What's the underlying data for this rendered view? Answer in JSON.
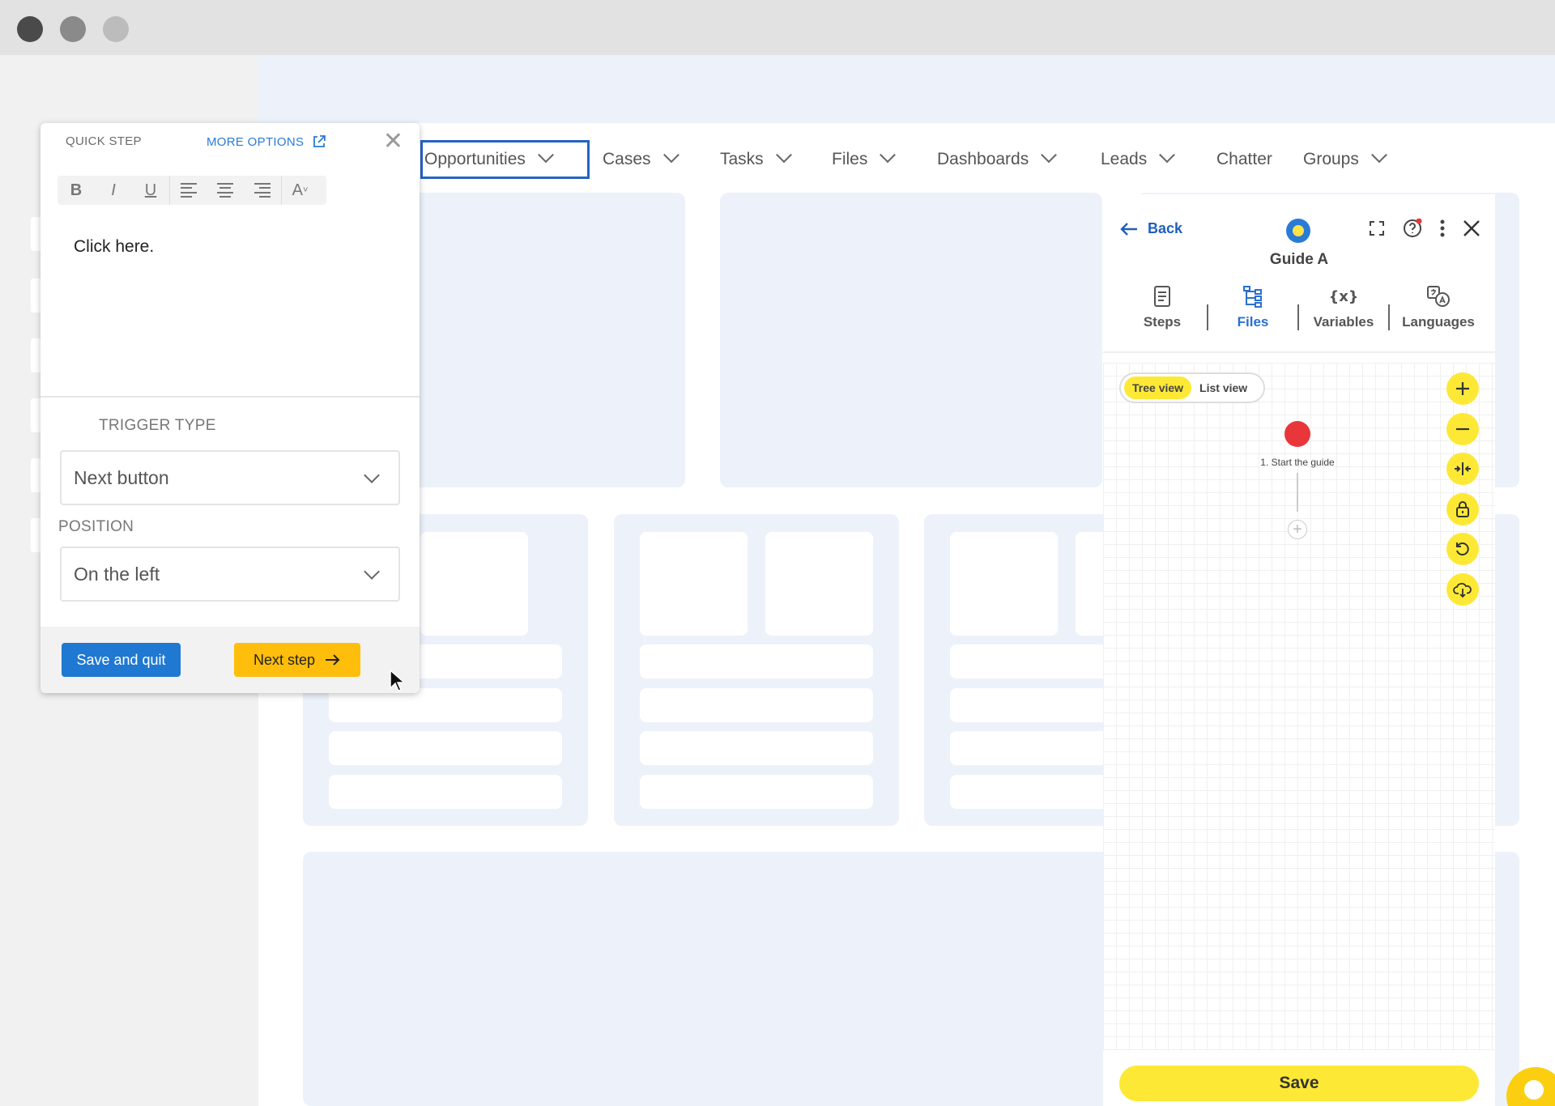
{
  "nav": {
    "items": [
      {
        "label": "Opportunities",
        "chevron": true,
        "active": true
      },
      {
        "label": "Cases",
        "chevron": true
      },
      {
        "label": "Tasks",
        "chevron": true
      },
      {
        "label": "Files",
        "chevron": true
      },
      {
        "label": "Dashboards",
        "chevron": true
      },
      {
        "label": "Leads",
        "chevron": true
      },
      {
        "label": "Chatter",
        "chevron": false
      },
      {
        "label": "Groups",
        "chevron": true
      }
    ]
  },
  "quick_step": {
    "title": "QUICK STEP",
    "more_options": "MORE OPTIONS",
    "toolbar": [
      "bold-icon",
      "italic-icon",
      "underline-icon",
      "align-left-icon",
      "align-center-icon",
      "align-right-icon",
      "font-size-icon"
    ],
    "toolbar_glyphs": {
      "bold": "B",
      "italic": "I",
      "underline": "U",
      "font": "A"
    },
    "content": "Click here.",
    "trigger_label": "TRIGGER TYPE",
    "trigger_value": "Next button",
    "position_label": "POSITION",
    "position_value": "On the left",
    "save_quit": "Save and quit",
    "next_step": "Next step"
  },
  "guide": {
    "back": "Back",
    "title": "Guide A",
    "tabs": [
      {
        "label": "Steps",
        "icon": "steps-icon"
      },
      {
        "label": "Files",
        "icon": "files-tree-icon",
        "active": true
      },
      {
        "label": "Variables",
        "icon": "variables-icon"
      },
      {
        "label": "Languages",
        "icon": "languages-icon"
      }
    ],
    "view_tree": "Tree view",
    "view_list": "List view",
    "node_label": "1. Start the guide",
    "add_glyph": "+",
    "save": "Save"
  },
  "colors": {
    "accent_blue": "#2a6fd1",
    "accent_yellow": "#fde935",
    "node_red": "#e8363a",
    "next_orange": "#ffbe0b"
  }
}
